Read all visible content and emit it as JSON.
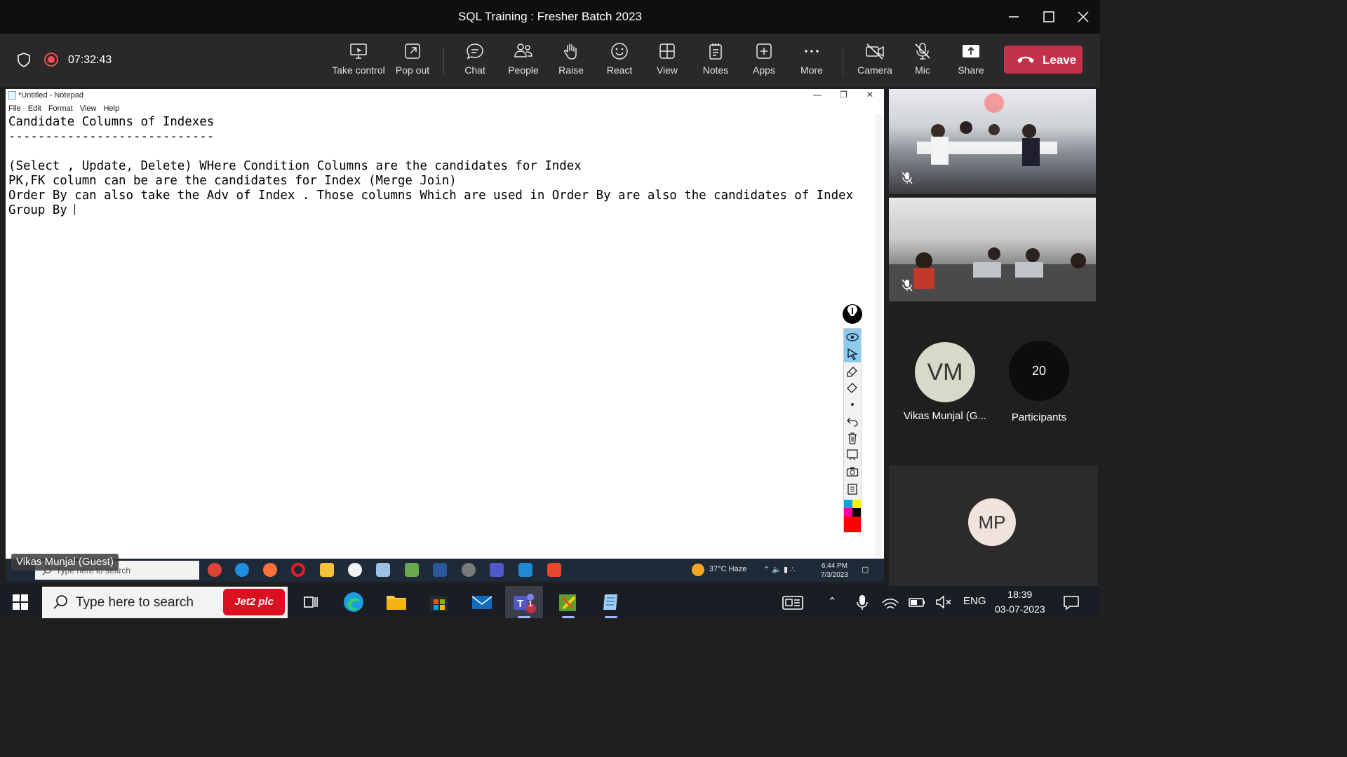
{
  "window": {
    "title": "SQL Training : Fresher Batch 2023"
  },
  "meeting": {
    "timer": "07:32:43"
  },
  "toolbar": {
    "take_control": "Take control",
    "pop_out": "Pop out",
    "chat": "Chat",
    "people": "People",
    "raise": "Raise",
    "react": "React",
    "view": "View",
    "notes": "Notes",
    "apps": "Apps",
    "more": "More",
    "camera": "Camera",
    "mic": "Mic",
    "share": "Share",
    "leave": "Leave"
  },
  "notepad": {
    "title": "*Untitled - Notepad",
    "menu": [
      "File",
      "Edit",
      "Format",
      "View",
      "Help"
    ],
    "lines": [
      "Candidate Columns of Indexes",
      "----------------------------",
      "",
      "(Select , Update, Delete) WHere Condition Columns are the candidates for Index",
      "PK,FK column can be are the candidates for Index (Merge Join)",
      "Order By can also take the Adv of Index . Those columns Which are used in Order By are also the candidates of Index",
      "Group By "
    ]
  },
  "remote_taskbar": {
    "search_placeholder": "Type here to search",
    "weather": "37°C  Haze",
    "time": "6:44 PM",
    "date": "7/3/2023"
  },
  "presenter_tag": "Vikas Munjal (Guest)",
  "participants": {
    "vm_initials": "VM",
    "vm_name": "Vikas Munjal (G...",
    "count": "20",
    "count_label": "Participants",
    "mp_initials": "MP"
  },
  "taskbar": {
    "search_placeholder": "Type here to search",
    "jet2": "Jet2 plc",
    "teams_badge": "1",
    "lang": "ENG",
    "time": "18:39",
    "date": "03-07-2023"
  },
  "colors": {
    "leave": "#c4314b",
    "recording": "#e6505a",
    "palette_selected": "#8ccbee"
  }
}
